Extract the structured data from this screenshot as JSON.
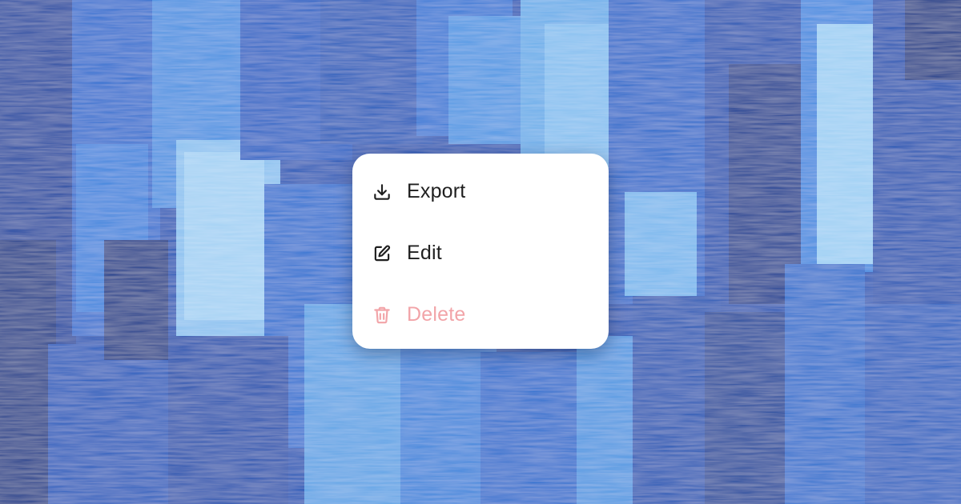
{
  "background": {
    "description_color": "#1f5fc0"
  },
  "menu": {
    "items": [
      {
        "label": "Export",
        "icon": "download-icon",
        "color": "#1f1f1f",
        "enabled": true
      },
      {
        "label": "Edit",
        "icon": "edit-icon",
        "color": "#1f1f1f",
        "enabled": true
      },
      {
        "label": "Delete",
        "icon": "trash-icon",
        "color": "#f2a4a8",
        "enabled": false
      }
    ]
  }
}
